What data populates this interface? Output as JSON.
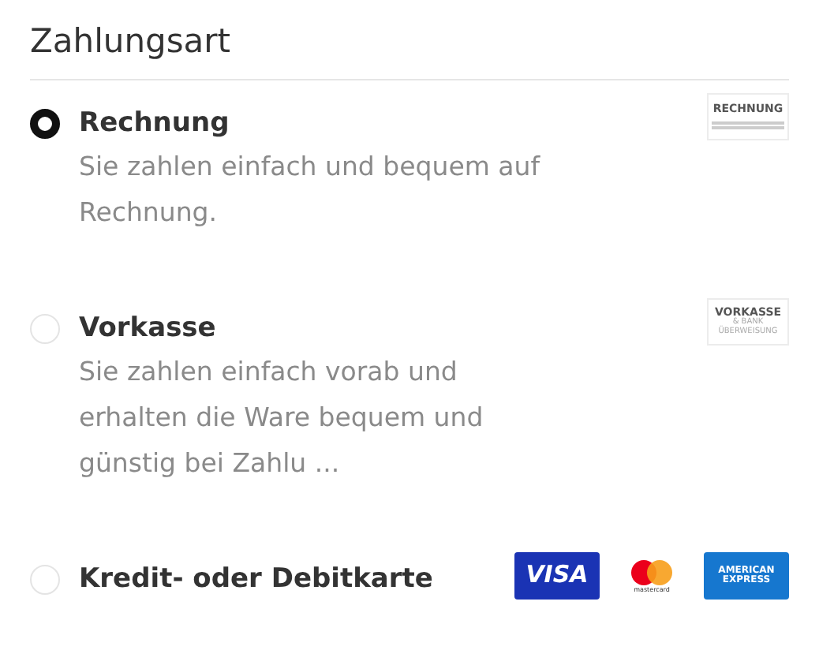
{
  "title": "Zahlungsart",
  "options": [
    {
      "label": "Rechnung",
      "description": "Sie zahlen einfach und bequem auf Rechnung.",
      "selected": true,
      "logos": [
        {
          "kind": "text-badge",
          "lines": [
            "RECHNUNG"
          ]
        }
      ]
    },
    {
      "label": "Vorkasse",
      "description": "Sie zahlen einfach vorab und erhalten die Ware bequem und günstig bei Zahlu ...",
      "selected": false,
      "logos": [
        {
          "kind": "text-badge",
          "lines": [
            "VORKASSE",
            "& BANK",
            "ÜBERWEISUNG"
          ]
        }
      ]
    },
    {
      "label": "Kredit- oder Debitkarte",
      "selected": false,
      "logos": [
        {
          "kind": "visa",
          "lines": [
            "VISA"
          ]
        },
        {
          "kind": "mastercard",
          "lines": [
            "mastercard"
          ]
        },
        {
          "kind": "amex",
          "lines": [
            "AMERICAN",
            "EXPRESS"
          ]
        }
      ]
    }
  ]
}
